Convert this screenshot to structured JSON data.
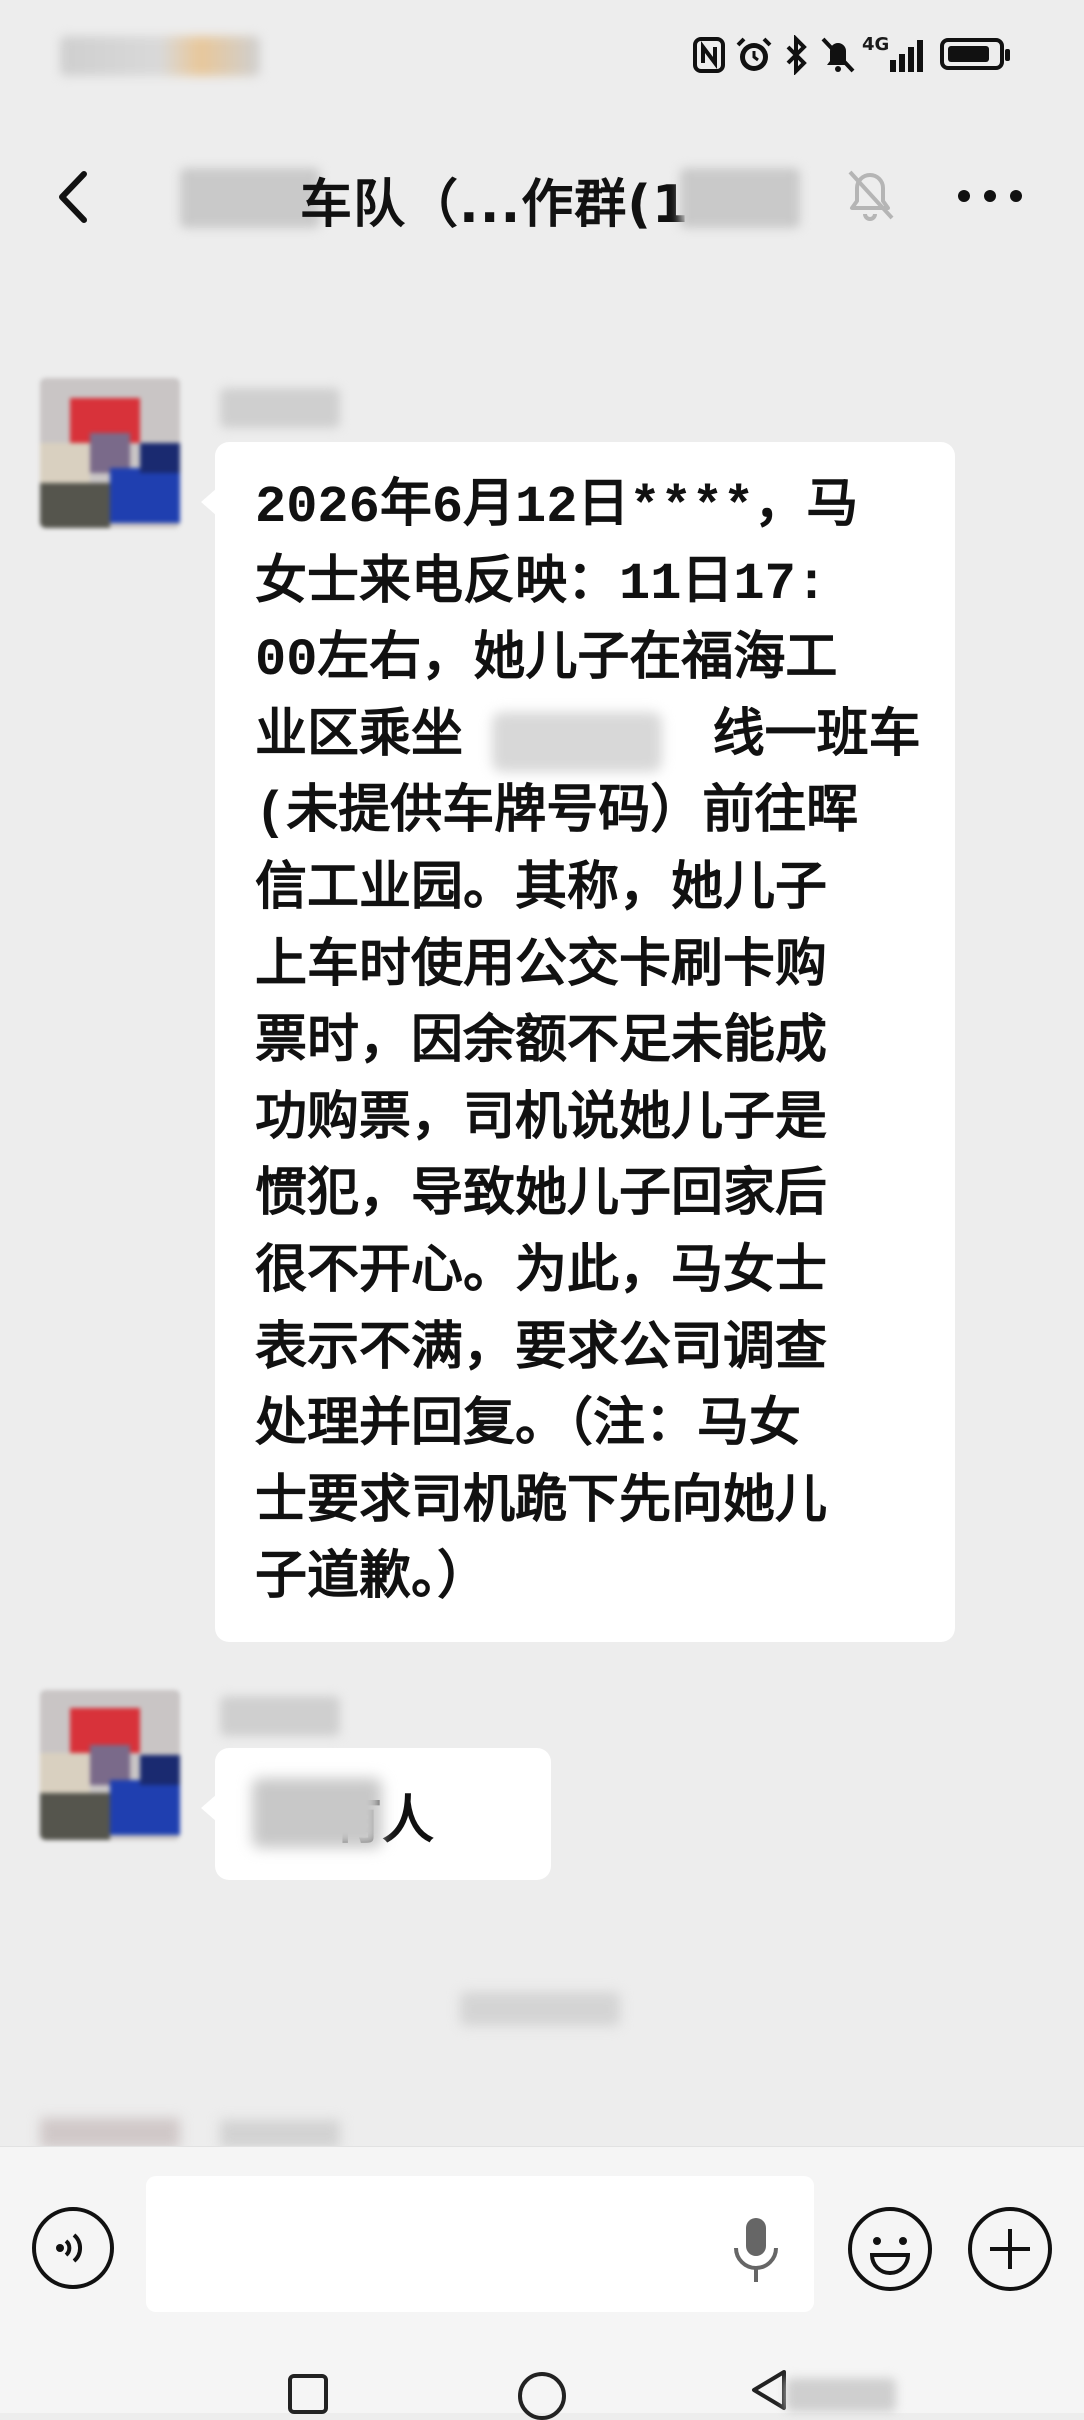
{
  "status_bar": {
    "icons": [
      "nfc-icon",
      "alarm-icon",
      "bluetooth-icon",
      "do-not-disturb-icon",
      "signal-4g-icon",
      "battery-icon"
    ],
    "network_label": "4G",
    "battery_level": 0.85
  },
  "header": {
    "title": "车队（...作群(1",
    "icons": [
      "back-arrow-icon",
      "mute-bell-icon",
      "more-dots-icon"
    ]
  },
  "messages": [
    {
      "text": "2026年6月12日****，马\n女士来电反映：11日17:\n00左右，她儿子在福海工\n业区乘坐        线一班车\n(未提供车牌号码）前往晖\n信工业园。其称，她儿子\n上车时使用公交卡刷卡购\n票时，因余额不足未能成\n功购票，司机说她儿子是\n惯犯，导致她儿子回家后\n很不开心。为此，马女士\n表示不满，要求公司调查\n处理并回复。（注：马女\n士要求司机跪下先向她儿\n子道歉。）"
    },
    {
      "text": "有人"
    }
  ],
  "colors": {
    "background": "#ededed",
    "bubble": "#ffffff",
    "input_bar": "#f5f5f5",
    "text": "#111111"
  },
  "input_bar": {
    "icons": [
      "voice-icon",
      "microphone-icon",
      "emoji-icon",
      "plus-icon"
    ]
  },
  "nav_bar": {
    "icons": [
      "recent-apps-icon",
      "home-icon",
      "back-icon"
    ]
  }
}
